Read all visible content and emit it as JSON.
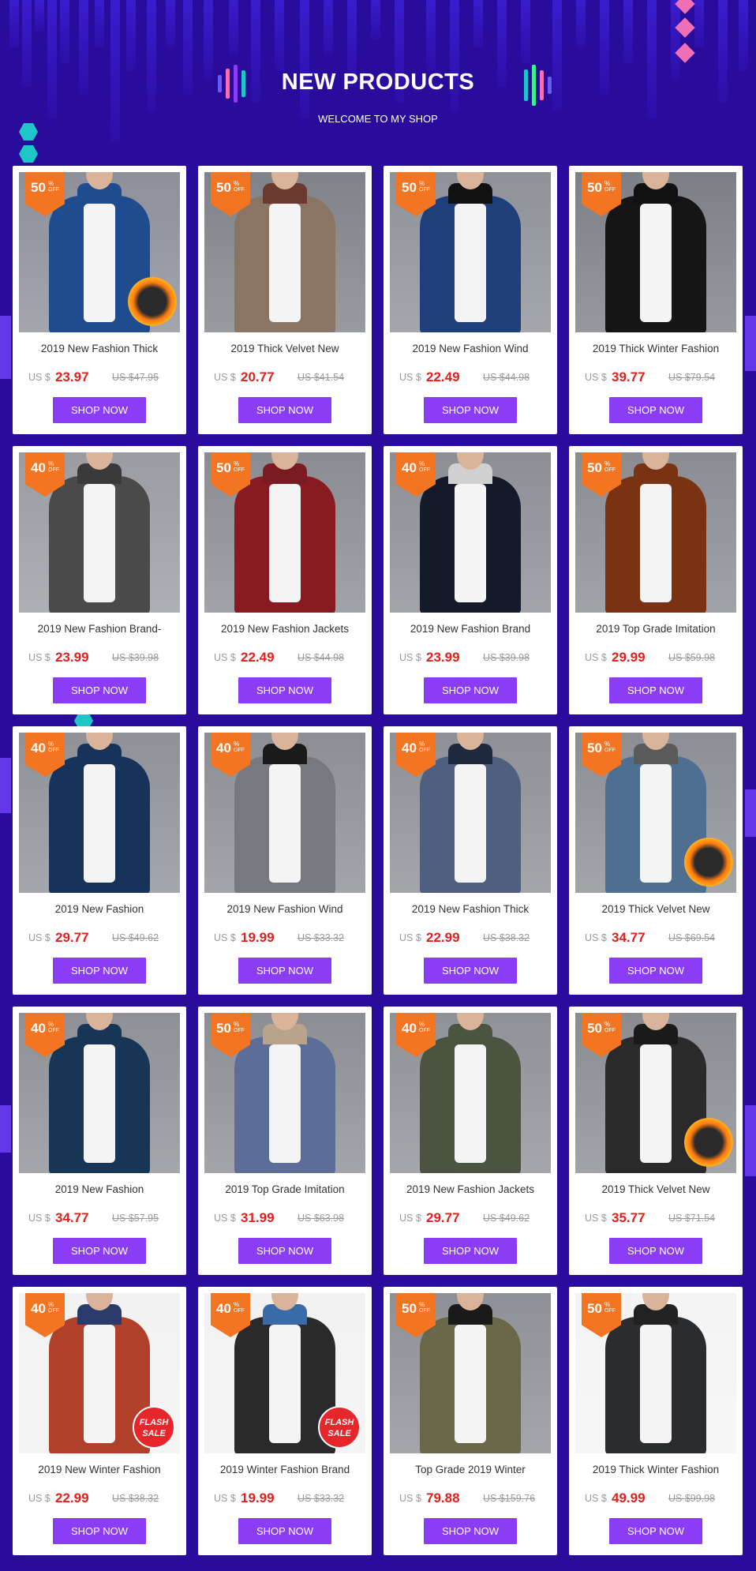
{
  "header": {
    "title": "NEW PRODUCTS",
    "subtitle": "WELCOME TO MY SHOP"
  },
  "colors": {
    "background": "#2a0c9c",
    "button": "#8a3df4",
    "badge": "#f37421",
    "price": "#e0201d"
  },
  "badge_percent": "%",
  "badge_off": "OFF",
  "currency": "US $",
  "button_label": "SHOP NOW",
  "flash_label": "FLASH SALE",
  "products": [
    {
      "title": "2019 New Fashion Thick",
      "discount": "50",
      "price": "23.97",
      "old_price": "US $47.95",
      "extra": "hot",
      "jacket": "#1f4c8f",
      "collar": "#1f4c8f",
      "bg": "#8d8f99"
    },
    {
      "title": "2019 Thick Velvet New",
      "discount": "50",
      "price": "20.77",
      "old_price": "US $41.54",
      "extra": "",
      "jacket": "#8a7565",
      "collar": "#6a3a2e",
      "bg": "#7f8288"
    },
    {
      "title": "2019 New Fashion Wind",
      "discount": "50",
      "price": "22.49",
      "old_price": "US $44.98",
      "extra": "",
      "jacket": "#1f3f7a",
      "collar": "#111111",
      "bg": "#8f9199"
    },
    {
      "title": "2019 Thick Winter Fashion",
      "discount": "50",
      "price": "39.77",
      "old_price": "US $79.54",
      "extra": "",
      "jacket": "#151515",
      "collar": "#111111",
      "bg": "#7d7f86"
    },
    {
      "title": "2019 New Fashion Brand-",
      "discount": "40",
      "price": "23.99",
      "old_price": "US $39.98",
      "extra": "",
      "jacket": "#4a4a4a",
      "collar": "#3a3a3a",
      "bg": "#9a9ca2"
    },
    {
      "title": "2019 New Fashion Jackets",
      "discount": "50",
      "price": "22.49",
      "old_price": "US $44.98",
      "extra": "",
      "jacket": "#8a1a22",
      "collar": "#7a1a22",
      "bg": "#8a8c92"
    },
    {
      "title": "2019 New Fashion Brand",
      "discount": "40",
      "price": "23.99",
      "old_price": "US $39.98",
      "extra": "",
      "jacket": "#141a2a",
      "collar": "#d0d0d0",
      "bg": "#8c8e94"
    },
    {
      "title": "2019 Top Grade Imitation",
      "discount": "50",
      "price": "29.99",
      "old_price": "US $59.98",
      "extra": "",
      "jacket": "#7a3312",
      "collar": "#7a3312",
      "bg": "#8a8c92"
    },
    {
      "title": "2019 New Fashion",
      "discount": "40",
      "price": "29.77",
      "old_price": "US $49.62",
      "extra": "",
      "jacket": "#17335a",
      "collar": "#17335a",
      "bg": "#8f9197"
    },
    {
      "title": "2019 New Fashion Wind",
      "discount": "40",
      "price": "19.99",
      "old_price": "US $33.32",
      "extra": "",
      "jacket": "#77797e",
      "collar": "#1a1a1a",
      "bg": "#8c8e94"
    },
    {
      "title": "2019 New Fashion Thick",
      "discount": "40",
      "price": "22.99",
      "old_price": "US $38.32",
      "extra": "",
      "jacket": "#4e5f80",
      "collar": "#202a3e",
      "bg": "#8e9096"
    },
    {
      "title": "2019 Thick Velvet New",
      "discount": "50",
      "price": "34.77",
      "old_price": "US $69.54",
      "extra": "hot",
      "jacket": "#4e6e92",
      "collar": "#5a5a5a",
      "bg": "#8c8e94"
    },
    {
      "title": "2019 New Fashion",
      "discount": "40",
      "price": "34.77",
      "old_price": "US $57.95",
      "extra": "",
      "jacket": "#173555",
      "collar": "#173555",
      "bg": "#8e9096"
    },
    {
      "title": "2019 Top Grade Imitation",
      "discount": "50",
      "price": "31.99",
      "old_price": "US $63.98",
      "extra": "",
      "jacket": "#5c6e98",
      "collar": "#b8a48a",
      "bg": "#8c8e94"
    },
    {
      "title": "2019 New Fashion Jackets",
      "discount": "40",
      "price": "29.77",
      "old_price": "US $49.62",
      "extra": "",
      "jacket": "#4a5440",
      "collar": "#4a5440",
      "bg": "#8f9197"
    },
    {
      "title": "2019 Thick Velvet New",
      "discount": "50",
      "price": "35.77",
      "old_price": "US $71.54",
      "extra": "hot",
      "jacket": "#2a2a2a",
      "collar": "#1a1a1a",
      "bg": "#8a8c92"
    },
    {
      "title": "2019 New Winter Fashion",
      "discount": "40",
      "price": "22.99",
      "old_price": "US $38.32",
      "extra": "flash",
      "jacket": "#b0402a",
      "collar": "#2a3a6a",
      "bg": "#f2f2f2"
    },
    {
      "title": "2019 Winter Fashion Brand",
      "discount": "40",
      "price": "19.99",
      "old_price": "US $33.32",
      "extra": "flash",
      "jacket": "#2a2a2a",
      "collar": "#3a6aa8",
      "bg": "#f2f2f2"
    },
    {
      "title": "Top Grade 2019 Winter",
      "discount": "50",
      "price": "79.88",
      "old_price": "US $159.76",
      "extra": "",
      "jacket": "#6a6648",
      "collar": "#1a1a1a",
      "bg": "#8e9096"
    },
    {
      "title": "2019 Thick Winter Fashion",
      "discount": "50",
      "price": "49.99",
      "old_price": "US $99.98",
      "extra": "",
      "jacket": "#2a2c30",
      "collar": "#222222",
      "bg": "#f4f4f4"
    }
  ]
}
